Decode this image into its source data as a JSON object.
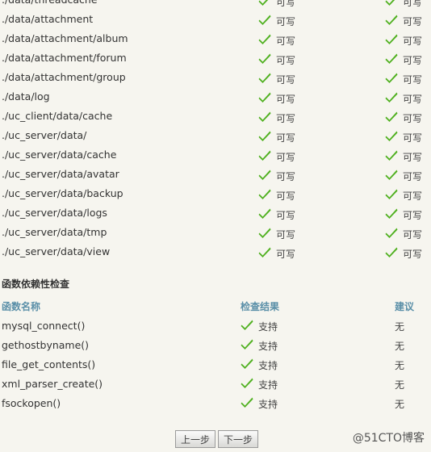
{
  "directory_check": {
    "rows": [
      {
        "path": "./data/threadcache",
        "current": "可写",
        "required": "可写"
      },
      {
        "path": "./data/attachment",
        "current": "可写",
        "required": "可写"
      },
      {
        "path": "./data/attachment/album",
        "current": "可写",
        "required": "可写"
      },
      {
        "path": "./data/attachment/forum",
        "current": "可写",
        "required": "可写"
      },
      {
        "path": "./data/attachment/group",
        "current": "可写",
        "required": "可写"
      },
      {
        "path": "./data/log",
        "current": "可写",
        "required": "可写"
      },
      {
        "path": "./uc_client/data/cache",
        "current": "可写",
        "required": "可写"
      },
      {
        "path": "./uc_server/data/",
        "current": "可写",
        "required": "可写"
      },
      {
        "path": "./uc_server/data/cache",
        "current": "可写",
        "required": "可写"
      },
      {
        "path": "./uc_server/data/avatar",
        "current": "可写",
        "required": "可写"
      },
      {
        "path": "./uc_server/data/backup",
        "current": "可写",
        "required": "可写"
      },
      {
        "path": "./uc_server/data/logs",
        "current": "可写",
        "required": "可写"
      },
      {
        "path": "./uc_server/data/tmp",
        "current": "可写",
        "required": "可写"
      },
      {
        "path": "./uc_server/data/view",
        "current": "可写",
        "required": "可写"
      }
    ]
  },
  "function_check": {
    "title": "函数依赖性检查",
    "headers": {
      "name": "函数名称",
      "result": "检查结果",
      "suggestion": "建议"
    },
    "rows": [
      {
        "name": "mysql_connect()",
        "result": "支持",
        "suggestion": "无"
      },
      {
        "name": "gethostbyname()",
        "result": "支持",
        "suggestion": "无"
      },
      {
        "name": "file_get_contents()",
        "result": "支持",
        "suggestion": "无"
      },
      {
        "name": "xml_parser_create()",
        "result": "支持",
        "suggestion": "无"
      },
      {
        "name": "fsockopen()",
        "result": "支持",
        "suggestion": "无"
      }
    ]
  },
  "buttons": {
    "prev": "上一步",
    "next": "下一步"
  },
  "watermark": "@51CTO博客",
  "colors": {
    "background": "#f6f5ef",
    "check": "#4fb01f",
    "header": "#5a8fa8"
  },
  "icons": {
    "check": "check-icon"
  }
}
